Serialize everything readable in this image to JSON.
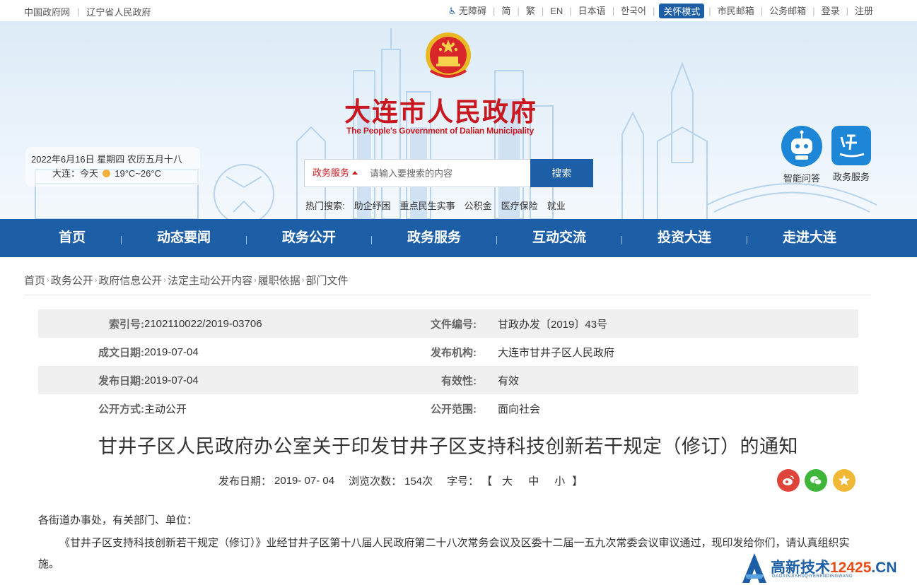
{
  "topbar": {
    "left_links": [
      "中国政府网",
      "辽宁省人民政府"
    ],
    "accessibility": "无障碍",
    "simplified": "简",
    "traditional": "繁",
    "english": "EN",
    "japanese": "日本语",
    "korean": "한국어",
    "care_mode": "关怀模式",
    "citizen_mail": "市民邮箱",
    "gov_mail": "公务邮箱",
    "login": "登录",
    "register": "注册"
  },
  "banner": {
    "title": "大连市人民政府",
    "subtitle": "The People's Government of Dalian Municipality",
    "date_line": "2022年6月16日 星期四 农历五月十八",
    "weather_prefix": "大连：今天",
    "weather_temp": "19°C~26°C",
    "search": {
      "category": "政务服务",
      "placeholder": "请输入要搜索的内容",
      "button": "搜索"
    },
    "hot_label": "热门搜索:",
    "hot_terms": [
      "助企纾困",
      "重点民生实事",
      "公积金",
      "医疗保险",
      "就业"
    ],
    "quick_links": [
      "智能问答",
      "政务服务"
    ]
  },
  "nav": [
    "首页",
    "动态要闻",
    "政务公开",
    "政务服务",
    "互动交流",
    "投资大连",
    "走进大连"
  ],
  "breadcrumb": [
    "首页",
    "政务公开",
    "政府信息公开",
    "法定主动公开内容",
    "履职依据",
    "部门文件"
  ],
  "meta": {
    "index_no_label": "索引号:",
    "index_no": "2102110022/2019-03706",
    "doc_no_label": "文件编号:",
    "doc_no": "甘政办发〔2019〕43号",
    "written_date_label": "成文日期:",
    "written_date": "2019-07-04",
    "issuer_label": "发布机构:",
    "issuer": "大连市甘井子区人民政府",
    "publish_date_label": "发布日期:",
    "publish_date": "2019-07-04",
    "validity_label": "有效性:",
    "validity": "有效",
    "open_method_label": "公开方式:",
    "open_method": "主动公开",
    "open_scope_label": "公开范围:",
    "open_scope": "面向社会"
  },
  "doc": {
    "title": "甘井子区人民政府办公室关于印发甘井子区支持科技创新若干规定（修订）的通知",
    "info_date_label": "发布日期：",
    "info_date": "2019- 07- 04",
    "views_label": "浏览次数：",
    "views": "154次",
    "font_label": "字号：",
    "font_open": "【",
    "font_large": "大",
    "font_medium": "中",
    "font_small": "小",
    "font_close": "】",
    "salutation": "各街道办事处，有关部门、单位：",
    "paragraph": "《甘井子区支持科技创新若干规定（修订）》业经甘井子区第十八届人民政府第二十八次常务会议及区委十二届一五九次常委会议审议通过，现印发给你们，请认真组织实施。"
  },
  "watermark": {
    "text_blue": "高新技术",
    "text_orange": "12425",
    "text_cn": ".CN",
    "sub": "GAOXINJISHUQIYERENDINGWANG"
  },
  "colors": {
    "primary_blue": "#1d5fa6",
    "title_red": "#c8171e",
    "weibo": "#e0433a",
    "wechat": "#3fb63a",
    "favorite": "#f0b835"
  }
}
